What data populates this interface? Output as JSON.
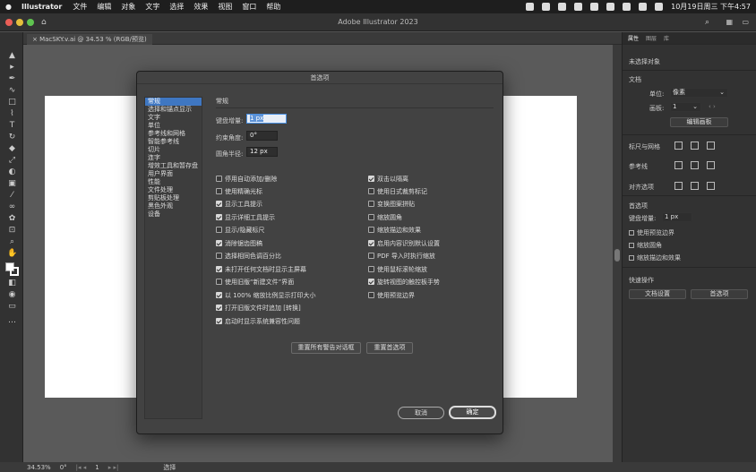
{
  "menubar": {
    "app": "Illustrator",
    "menus": [
      "文件",
      "编辑",
      "对象",
      "文字",
      "选择",
      "效果",
      "视图",
      "窗口",
      "帮助"
    ],
    "clock": "10月19日周三 下午4:57"
  },
  "window": {
    "title": "Adobe Illustrator 2023"
  },
  "doc_tab": {
    "label": "× MacSKY.v.ai @ 34.53 % (RGB/预览)"
  },
  "dialog": {
    "title": "首选项",
    "categories": [
      "常规",
      "选择和锚点显示",
      "文字",
      "单位",
      "参考线和网格",
      "智能参考线",
      "切片",
      "连字",
      "增效工具和暂存盘",
      "用户界面",
      "性能",
      "文件处理",
      "剪贴板处理",
      "黑色外观",
      "设备"
    ],
    "section_title": "常规",
    "fields": {
      "keyboard_increment_label": "键盘增量:",
      "keyboard_increment_value": "1 px",
      "constrain_angle_label": "约束角度:",
      "constrain_angle_value": "0°",
      "corner_radius_label": "圆角半径:",
      "corner_radius_value": "12 px"
    },
    "left_checks": [
      {
        "label": "停用自动添加/删除",
        "checked": false
      },
      {
        "label": "使用精确光标",
        "checked": false
      },
      {
        "label": "显示工具提示",
        "checked": true
      },
      {
        "label": "显示详细工具提示",
        "checked": true
      },
      {
        "label": "显示/隐藏标尺",
        "checked": false
      },
      {
        "label": "消除锯齿图稿",
        "checked": true
      },
      {
        "label": "选择相同色调百分比",
        "checked": false
      },
      {
        "label": "未打开任何文档时显示主屏幕",
        "checked": true
      },
      {
        "label": "使用旧版“新建文件”界面",
        "checked": false
      },
      {
        "label": "以 100% 缩放比例显示打印大小",
        "checked": true
      },
      {
        "label": "打开旧版文件时追加 [转换]",
        "checked": true
      },
      {
        "label": "启动时显示系统兼容性问题",
        "checked": true
      }
    ],
    "right_checks": [
      {
        "label": "双击以隔离",
        "checked": true
      },
      {
        "label": "使用日式裁剪标记",
        "checked": false
      },
      {
        "label": "变换图案拼贴",
        "checked": false
      },
      {
        "label": "缩放圆角",
        "checked": false
      },
      {
        "label": "缩放描边和效果",
        "checked": false
      },
      {
        "label": "启用内容识别默认设置",
        "checked": true
      },
      {
        "label": "PDF 导入时执行缩放",
        "checked": false
      },
      {
        "label": "使用鼠标滚轮缩放",
        "checked": false
      },
      {
        "label": "旋转视图的触控板手势",
        "checked": true
      },
      {
        "label": "使用预览边界",
        "checked": false
      }
    ],
    "reset_warnings": "重置所有警告对话框",
    "reset_prefs": "重置首选项",
    "cancel": "取消",
    "ok": "确定"
  },
  "right_panel": {
    "tabs": [
      "属性",
      "图层",
      "库"
    ],
    "no_selection": "未选择对象",
    "document": "文档",
    "units_label": "单位:",
    "units_value": "像素",
    "artboard_label": "画板:",
    "artboard_value": "1",
    "edit_artboard": "编辑画板",
    "rulers_grids": "标尺与网格",
    "guides": "参考线",
    "snap_options": "对齐选项",
    "preferences": "首选项",
    "keyboard_increment_label": "键盘增量:",
    "keyboard_increment_value": "1 px",
    "use_preview_bounds": "使用预览边界",
    "scale_corners": "缩放圆角",
    "scale_strokes": "缩放描边和效果",
    "quick_actions": "快速操作",
    "doc_setup": "文档设置",
    "prefs_button": "首选项"
  },
  "statusbar": {
    "zoom": "34.53%",
    "angle": "0°",
    "page": "1",
    "tool": "选择"
  }
}
